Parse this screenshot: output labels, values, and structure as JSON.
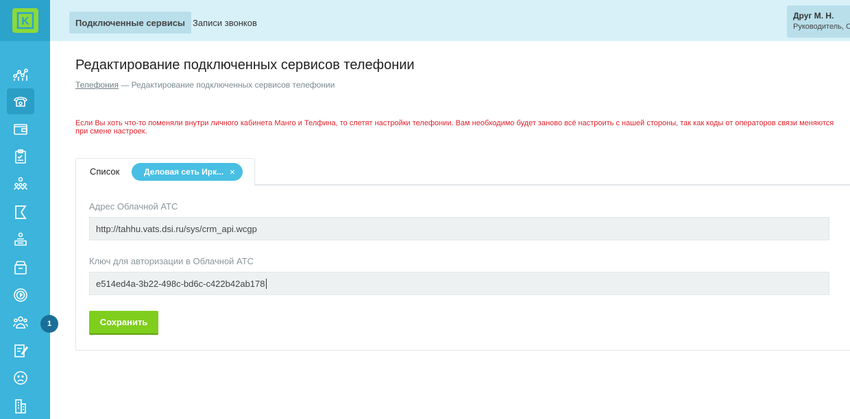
{
  "logo": {
    "letter": "K",
    "icon": "logo-k-icon"
  },
  "sidebar": {
    "items": [
      {
        "icon": "analytics-icon"
      },
      {
        "icon": "telephony-icon",
        "active": true
      },
      {
        "icon": "wallet-icon"
      },
      {
        "icon": "tasks-icon"
      },
      {
        "icon": "team-icon"
      },
      {
        "icon": "flag-icon"
      },
      {
        "icon": "reception-icon"
      },
      {
        "icon": "archive-icon"
      },
      {
        "icon": "finance-icon"
      },
      {
        "icon": "clients-icon",
        "badge": "1"
      },
      {
        "icon": "edit-icon"
      },
      {
        "icon": "complaints-icon"
      },
      {
        "icon": "buildings-icon"
      }
    ]
  },
  "topbar": {
    "tabs": [
      {
        "label": "Подключенные сервисы",
        "active": true
      },
      {
        "label": "Записи звонков",
        "active": false
      }
    ],
    "user": {
      "name": "Друг М. Н.",
      "role": "Руководитель, С"
    }
  },
  "page": {
    "title": "Редактирование подключенных сервисов телефонии",
    "breadcrumb": {
      "link": "Телефония",
      "separator": " — ",
      "current": "Редактирование подключенных сервисов телефонии"
    },
    "warning": "Если Вы хоть что-то поменяли внутри личного кабинета Манго и Телфина, то слетят настройки телефонии. Вам необходимо будет заново всё настроить с нашей стороны, так как коды от операторов связи меняются при смене настроек."
  },
  "tabs": {
    "list_label": "Список",
    "chip_label": "Деловая сеть Ирк...",
    "chip_close": "×"
  },
  "form": {
    "address_label": "Адрес Облачной АТС",
    "address_value": "http://tahhu.vats.dsi.ru/sys/crm_api.wcgp",
    "key_label": "Ключ для авторизации в Облачной АТС",
    "key_value": "e514ed4a-3b22-498c-bd6c-c422b42ab178",
    "save_label": "Сохранить"
  },
  "colors": {
    "sidebar": "#3cb4dc",
    "topbar": "#d8f1f8",
    "accent_green": "#7fce1d",
    "chip_blue": "#48bfe3",
    "warning_red": "#e0212b"
  }
}
